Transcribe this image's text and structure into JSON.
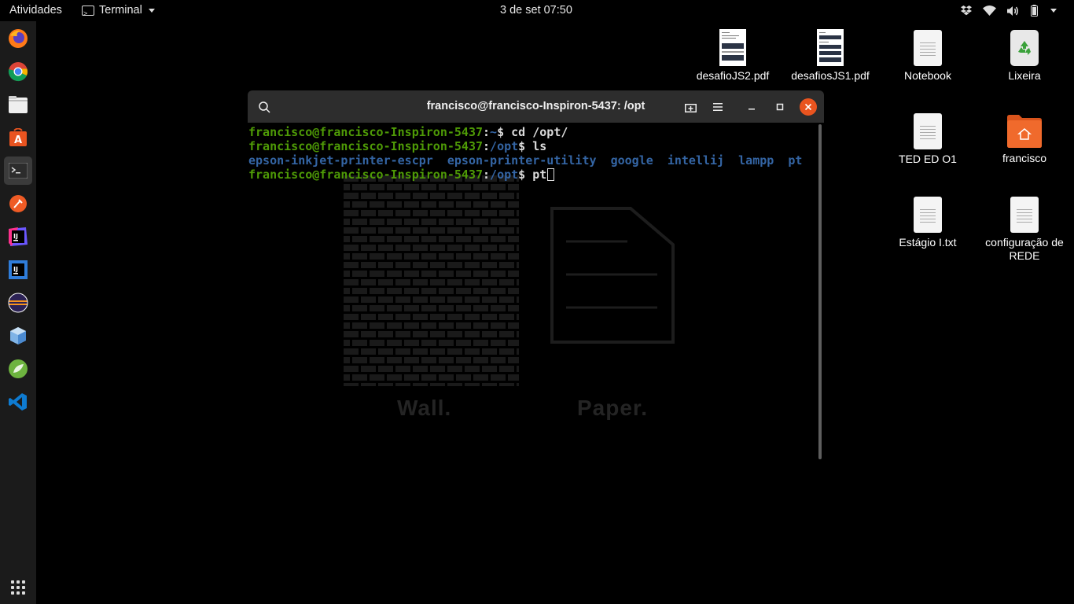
{
  "topbar": {
    "activities": "Atividades",
    "app_name": "Terminal",
    "clock": "3 de set  07:50"
  },
  "dock": {
    "items": [
      "firefox-icon",
      "chrome-icon",
      "files-icon",
      "software-icon",
      "terminal-icon",
      "postman-icon",
      "intellij-icon",
      "intellij-ce-icon",
      "eclipse-icon",
      "virtualbox-icon",
      "spring-icon",
      "vscode-icon"
    ],
    "active": "terminal-icon"
  },
  "wallpaper": {
    "wall_label": "Wall.",
    "paper_label": "Paper."
  },
  "desktop": {
    "icons": [
      {
        "label": "desafioJS2.pdf"
      },
      {
        "label": "desafiosJS1.pdf"
      },
      {
        "label": "Notebook"
      },
      {
        "label": "Lixeira"
      },
      {
        "label": "TED ED O1"
      },
      {
        "label": "francisco"
      },
      {
        "label": "Estágio I.txt"
      },
      {
        "label": "configuração de REDE"
      }
    ]
  },
  "terminal": {
    "title": "francisco@francisco-Inspiron-5437: /opt",
    "prompt_user": "francisco@francisco-Inspiron-5437",
    "lines": [
      {
        "path": "~",
        "command": "cd /opt/"
      },
      {
        "path": "/opt",
        "command": "ls"
      },
      {
        "path": "/opt",
        "command": "pt"
      }
    ],
    "ls_output": [
      "epson-inkjet-printer-escpr",
      "epson-printer-utility",
      "google",
      "intellij",
      "lampp",
      "pt"
    ]
  },
  "colors": {
    "prompt_user": "#4e9a06",
    "prompt_path": "#3465a4",
    "close_button": "#e9541f",
    "folder": "#f06a2c",
    "dock_bg": "#1b1b1b"
  }
}
